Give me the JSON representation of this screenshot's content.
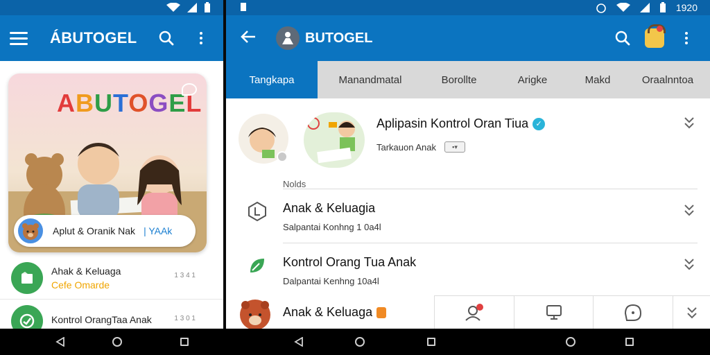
{
  "left": {
    "app_title": "ÁBUTOGEL",
    "hero": {
      "logo_letters": [
        "A",
        "B",
        "U",
        "T",
        "O",
        "G",
        "E",
        "L"
      ],
      "caption": "Aplut & Oranik Nak",
      "caption_accent": "| YAAk"
    },
    "list": [
      {
        "title": "Ahak & Keluaga",
        "subtitle": "Cefe Omarde",
        "time": "1 3 4 1"
      },
      {
        "title": "Kontrol OrangTaa Anak",
        "subtitle": "",
        "time": "1 3 0 1"
      }
    ]
  },
  "right": {
    "status_time": "1920",
    "app_title": "BUTOGEL",
    "tabs": [
      "Tangkapa",
      "Manandmatal",
      "Borollte",
      "Arigke",
      "Makd",
      "Oraalnntoa"
    ],
    "active_tab": 0,
    "profile": {
      "name": "Aplipasin Kontrol Oran Tiua",
      "sub": "Tarkauon Anak",
      "chip": "▪▾"
    },
    "section_label": "Nolds",
    "list": [
      {
        "title": "Anak & Keluagia",
        "subtitle": "Salpantai Konhng 1 0a4l"
      },
      {
        "title": "Kontrol Orang Tua Anak",
        "subtitle": "Dalpantai Kenhng 10a4l"
      }
    ],
    "bottom_item": {
      "title": "Anak & Keluaga"
    }
  },
  "icons": {
    "left_menu": "menu-icon",
    "search": "search-icon",
    "more": "more-vert-icon",
    "back": "arrow-back-icon",
    "chevron": "chevron-down-icon"
  },
  "colors": {
    "appbar": "#0b74c0",
    "statusbar": "#0b63a8",
    "tab_bg": "#d9d9d9",
    "accent_green": "#3aa655",
    "accent_orange": "#f0a500"
  }
}
